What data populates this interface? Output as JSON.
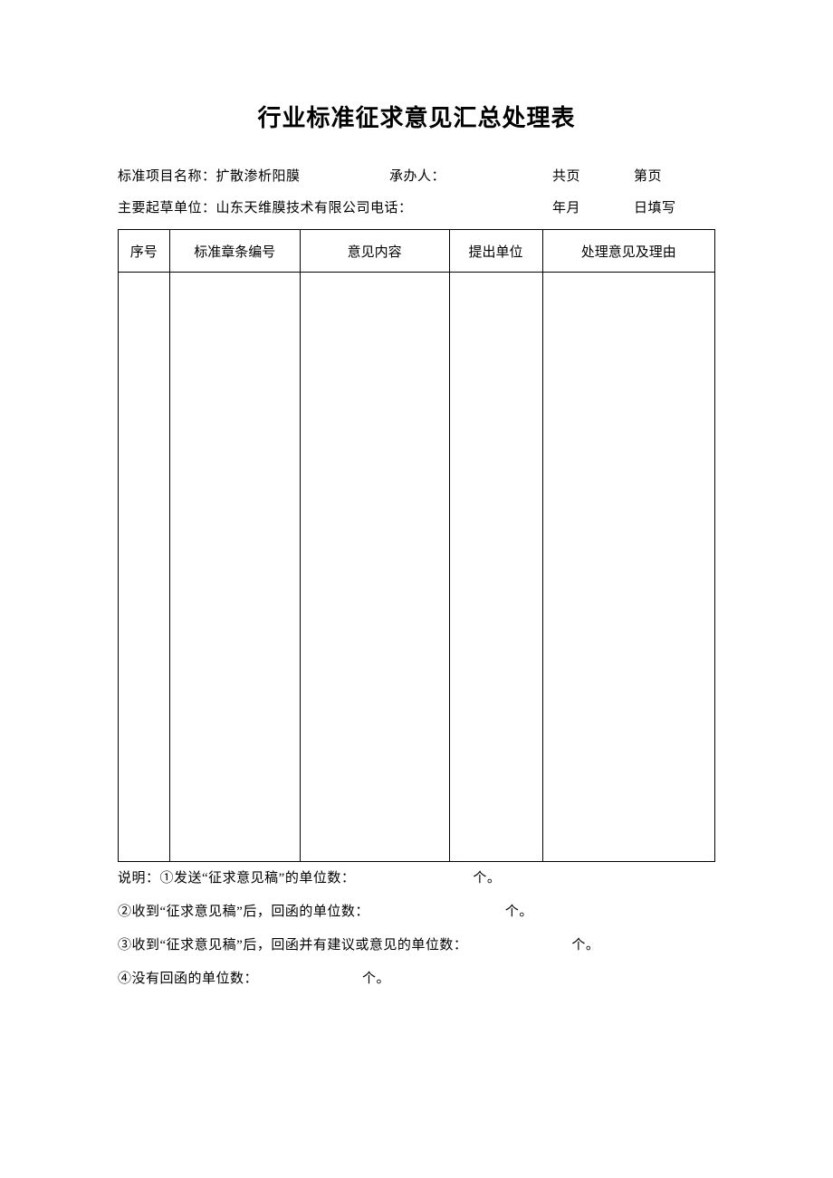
{
  "title": "行业标准征求意见汇总处理表",
  "meta": {
    "line1_seg1": "标准项目名称：扩散渗析阳膜",
    "line1_seg2": "承办人：",
    "line1_seg3": "共页",
    "line1_seg4": "第页",
    "line2_seg1": "主要起草单位：山东天维膜技术有限公司电话：",
    "line2_seg3": "年月",
    "line2_seg4": "日填写"
  },
  "table": {
    "headers": [
      "序号",
      "标准章条编号",
      "意见内容",
      "提出单位",
      "处理意见及理由"
    ]
  },
  "notes": {
    "n1_label": "说明：①发送“征求意见稿”的单位数：",
    "n1_tail": "个。",
    "n2_label": "②收到“征求意见稿”后，回函的单位数：",
    "n2_tail": "个。",
    "n3_label": "③收到“征求意见稿”后，回函并有建议或意见的单位数：",
    "n3_tail": "个。",
    "n4_label": "④没有回函的单位数：",
    "n4_tail": "个。"
  }
}
